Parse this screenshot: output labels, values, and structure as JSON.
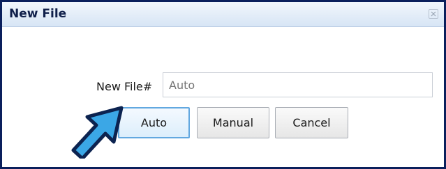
{
  "dialog": {
    "title": "New File",
    "close_icon": "close-icon"
  },
  "form": {
    "file_label": "New File#",
    "file_input_placeholder": "Auto"
  },
  "buttons": {
    "auto": "Auto",
    "manual": "Manual",
    "cancel": "Cancel"
  },
  "annotation": {
    "pointer_icon": "blue-arrow-icon",
    "color": "#3ba7e6"
  }
}
